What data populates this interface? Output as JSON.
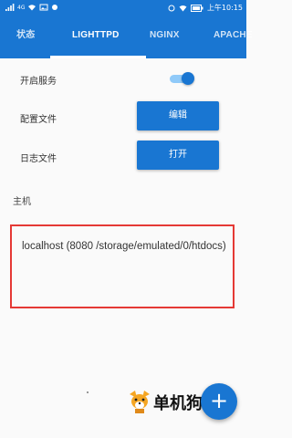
{
  "status_bar": {
    "network_label": "4G",
    "battery_icon": "battery-icon",
    "time": "上午10:15",
    "bg": "#1976d2"
  },
  "tabs": [
    {
      "label": "状态",
      "active": false
    },
    {
      "label": "LIGHTTPD",
      "active": true
    },
    {
      "label": "NGINX",
      "active": false
    },
    {
      "label": "APACHE",
      "active": false
    }
  ],
  "settings": {
    "enable_label": "开启服务",
    "enable_on": true,
    "config_label": "配置文件",
    "config_button": "编辑",
    "log_label": "日志文件",
    "log_button": "打开"
  },
  "host": {
    "section_label": "主机",
    "entry": "localhost (8080 /storage/emulated/0/htdocs)"
  },
  "watermark": {
    "text": "单机狗"
  },
  "fab": {
    "icon": "plus-icon",
    "label": "+"
  },
  "colors": {
    "accent": "#1976d2",
    "highlight_border": "#e53935"
  }
}
